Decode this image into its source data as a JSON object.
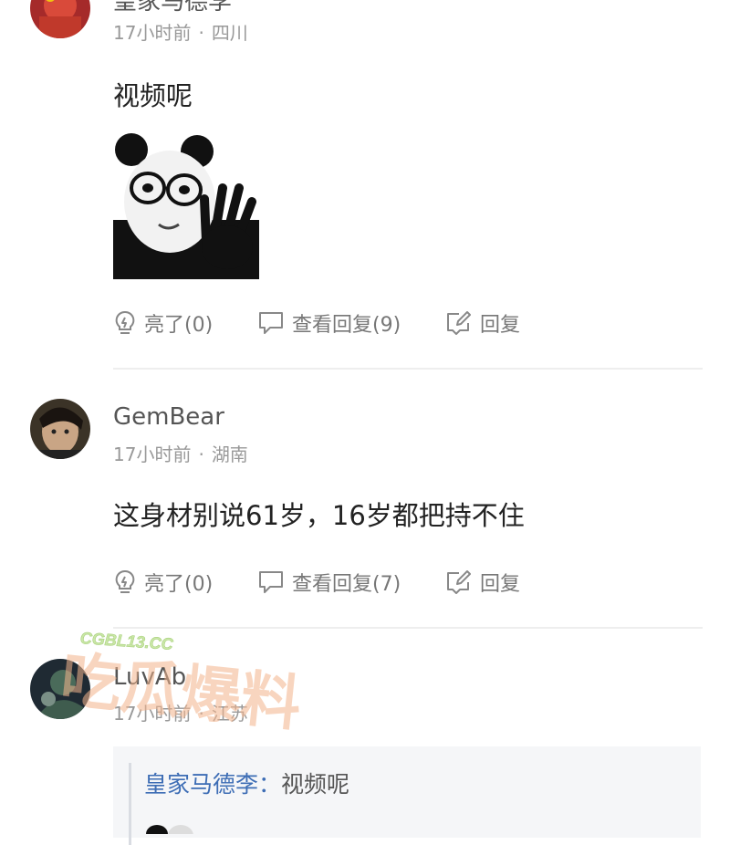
{
  "comments": [
    {
      "username": "皇家马德李",
      "time": "17小时前",
      "location": "四川",
      "text": "视频呢",
      "actions": {
        "like": "亮了(0)",
        "replies": "查看回复(9)",
        "reply": "回复"
      }
    },
    {
      "username": "GemBear",
      "time": "17小时前",
      "location": "湖南",
      "text": "这身材别说61岁，16岁都把持不住",
      "actions": {
        "like": "亮了(0)",
        "replies": "查看回复(7)",
        "reply": "回复"
      }
    },
    {
      "username": "LuvAb",
      "time": "17小时前",
      "location": "江苏",
      "quote": {
        "author": "皇家马德李：",
        "text": "视频呢"
      }
    }
  ],
  "separator": "·",
  "watermark": {
    "url": "CGBL13.CC",
    "text": "吃瓜爆料"
  },
  "colors": {
    "link": "#3d6db5",
    "meta": "#999999",
    "divider": "#eeeeee",
    "quote_bg": "#f5f6f8"
  },
  "icons": [
    "bulb-icon",
    "comment-bubble-icon",
    "edit-icon"
  ]
}
